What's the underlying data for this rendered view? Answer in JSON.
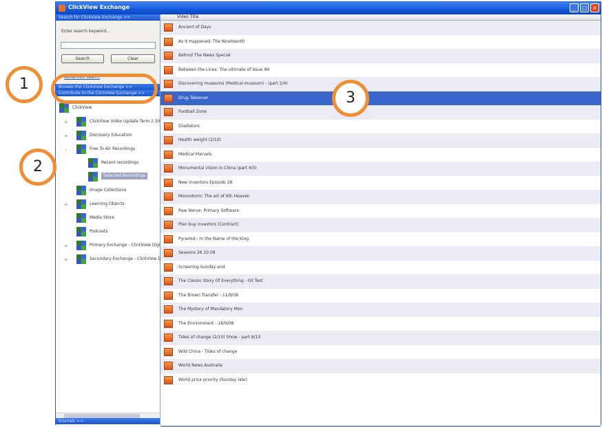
{
  "window": {
    "title": "ClickView Exchange",
    "controls": {
      "minimize": "_",
      "maximize": "□",
      "close": "×"
    }
  },
  "sidebar": {
    "search_header": "Search for ClickView Exchange >>",
    "search_label": "Enter search keyword...",
    "search_value": "",
    "search_button": "Search",
    "clear_button": "Clear",
    "advanced_link": "Advanced Search",
    "section_1": "Browse the ClickView Exchange >>",
    "section_2": "Contribute to the ClickView Exchange >>",
    "tree": [
      {
        "label": "ClickView",
        "level": 0,
        "expander": ""
      },
      {
        "label": "ClickView Video Update Term 2 20",
        "level": 1,
        "expander": "+"
      },
      {
        "label": "Discovery Education",
        "level": 1,
        "expander": "+"
      },
      {
        "label": "Free To Air Recordings",
        "level": 1,
        "expander": "-"
      },
      {
        "label": "Recent recordings",
        "level": 2,
        "expander": ""
      },
      {
        "label": "Selected Recordings",
        "level": 2,
        "expander": "",
        "selected": true
      },
      {
        "label": "Image Collections",
        "level": 1,
        "expander": ""
      },
      {
        "label": "Learning Objects",
        "level": 1,
        "expander": "+"
      },
      {
        "label": "Media Store",
        "level": 1,
        "expander": ""
      },
      {
        "label": "Podcasts",
        "level": 1,
        "expander": ""
      },
      {
        "label": "Primary Exchange - ClickView Digit",
        "level": 1,
        "expander": "+"
      },
      {
        "label": "Secondary Exchange - ClickView D",
        "level": 1,
        "expander": "+"
      }
    ],
    "footer": "Tutorials >>"
  },
  "list": {
    "column_header": "Video Title",
    "selected_index": 5,
    "rows": [
      "Ancient of Days",
      "As It Happened: The Nineteenth",
      "Behind The News Special",
      "Between the Lines: The ultimate of Issue 84",
      "Discovering museums (Medical museum) - (part 2/4)",
      "Drug Takeover",
      "Football Zone",
      "Gladiators",
      "Health weight (2/10)",
      "Medical Marvels",
      "Monumental vision in China (part 4/5)",
      "New Inventors Episode 28",
      "Moonstorm: The art of 6th Heaven",
      "Raw Nerve: Primary Software",
      "Plan buy investors (Contract)",
      "Pyramid - In the Name of the King",
      "Seasons 26.10.08",
      "Screening Sunday and",
      "The Classic Story Of Everything - Oil Test",
      "The Brown Transfer - 11/9/08",
      "The Mystery of Mandatory Men",
      "The Environment - 18/9/08",
      "Tides of change (2/10) Show - part 8/10",
      "Wild China - Tides of change",
      "World News Australia",
      "World price priority (Sunday late)"
    ]
  },
  "callouts": {
    "c1": "1",
    "c2": "2",
    "c3": "3"
  }
}
